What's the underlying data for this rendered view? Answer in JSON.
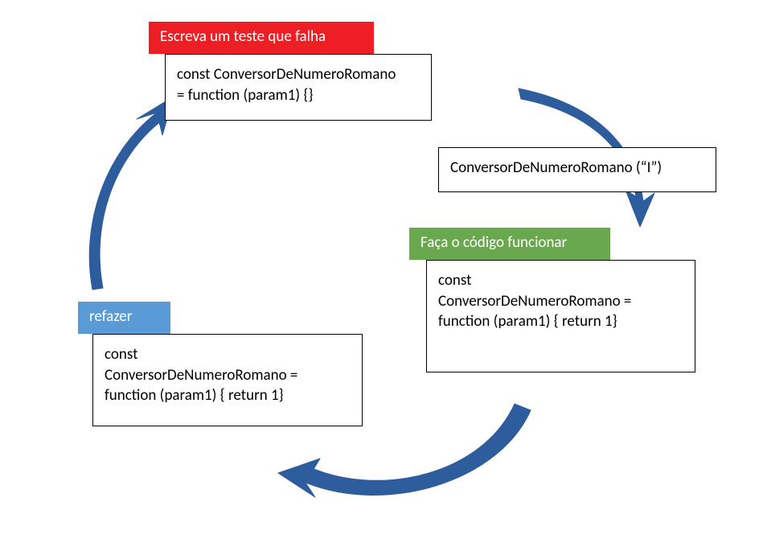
{
  "colors": {
    "red": "#ed1f24",
    "green": "#6aa84f",
    "blue": "#5b9bd5",
    "arrow": "#2e5d9e"
  },
  "steps": {
    "red": {
      "title": "Escreva um teste que falha",
      "code": [
        "const ConversorDeNumeroRomano",
        "= function (param1) {}"
      ]
    },
    "green": {
      "title": "Faça o código funcionar",
      "code": [
        "const",
        "ConversorDeNumeroRomano =",
        "function (param1) { return 1}"
      ]
    },
    "refactor": {
      "title": "refazer",
      "code": [
        "const",
        "ConversorDeNumeroRomano =",
        "function (param1) { return 1}"
      ]
    }
  },
  "call_box": {
    "code": [
      "ConversorDeNumeroRomano (“I”)"
    ]
  }
}
